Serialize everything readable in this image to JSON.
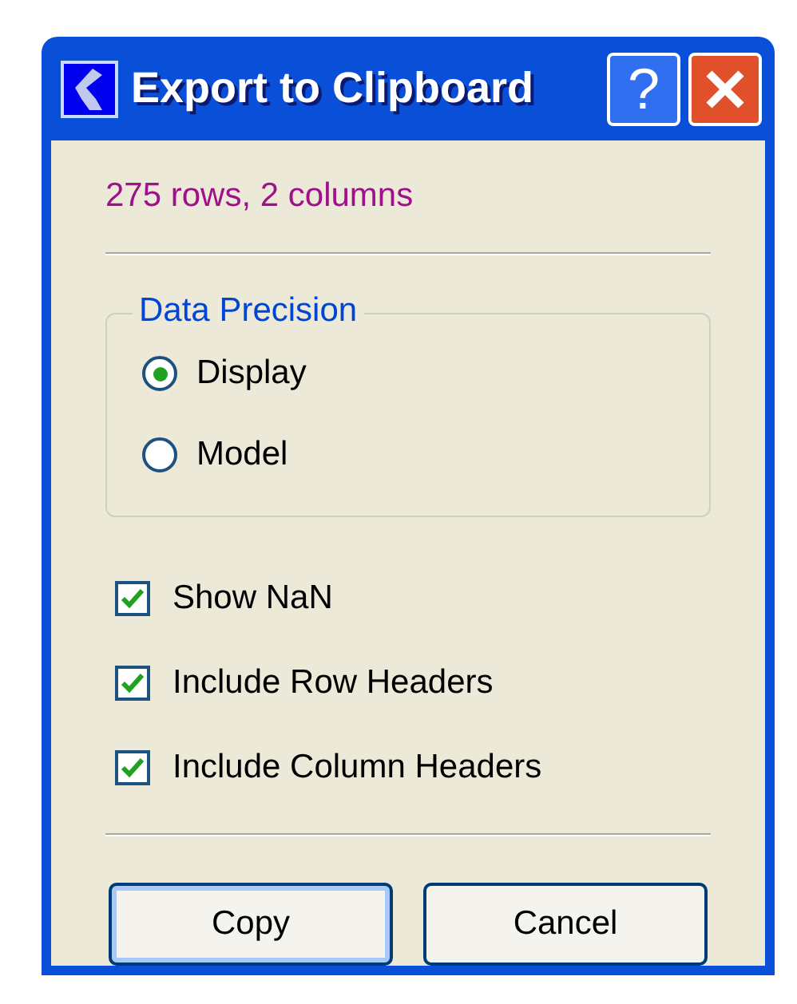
{
  "window": {
    "title": "Export to Clipboard",
    "title_buttons": [
      {
        "kind": "help",
        "label": "?"
      },
      {
        "kind": "close"
      }
    ]
  },
  "summary": "275 rows, 2 columns",
  "precision": {
    "title": "Data Precision",
    "options": [
      {
        "label": "Display",
        "selected": true
      },
      {
        "label": "Model",
        "selected": false
      }
    ]
  },
  "options": [
    {
      "label": "Show NaN",
      "checked": true
    },
    {
      "label": "Include Row Headers",
      "checked": true
    },
    {
      "label": "Include Column Headers",
      "checked": true
    }
  ],
  "buttons": [
    {
      "label": "Copy",
      "default": true
    },
    {
      "label": "Cancel",
      "default": false
    }
  ]
}
